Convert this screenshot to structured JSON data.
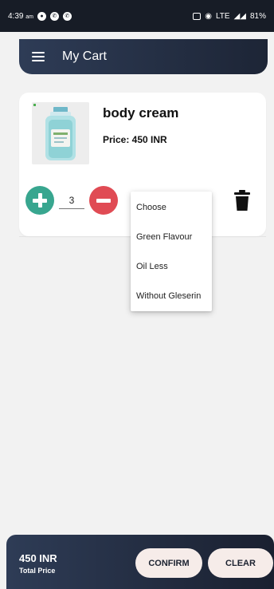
{
  "status_bar": {
    "time": "4:39",
    "ampm": "am",
    "network": "LTE",
    "battery": "81%"
  },
  "app_bar": {
    "title": "My Cart"
  },
  "cart_item": {
    "name": "body cream",
    "price": "Price: 450 INR",
    "quantity": "3"
  },
  "dropdown": {
    "options": [
      "Choose",
      "Green Flavour",
      "Oil Less",
      "Without Gleserin"
    ]
  },
  "bottom_bar": {
    "total_price": "450 INR",
    "total_label": "Total Price",
    "confirm_label": "CONFIRM",
    "clear_label": "CLEAR"
  },
  "colors": {
    "plus": "#38a68f",
    "minus": "#e04b54",
    "bar": "#2e3c56"
  }
}
